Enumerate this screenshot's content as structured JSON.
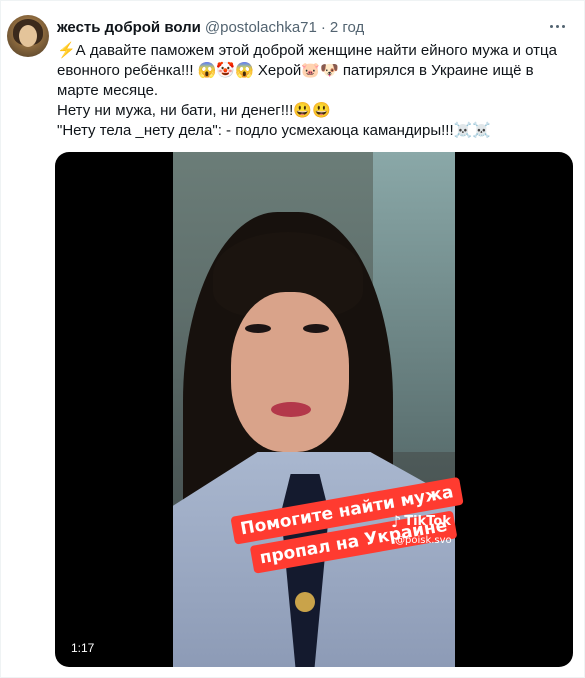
{
  "tweet": {
    "author_name": "жесть доброй воли",
    "handle": "@postolachka71",
    "separator": "·",
    "time": "2 год",
    "text_line1": "⚡А давайте паможем этой доброй женщине найти ейного мужа и отца евонного ребёнка!!! 😱🤡😱 Херой🐷🐶 патирялся в Украине ищё в марте месяце.",
    "text_line2": " Нету ни мужа, ни бати, ни денег!!!😃😃",
    "text_line3": " \"Нету тела _нету дела\": - подло усмехаюца камандиры!!!☠️☠️"
  },
  "video": {
    "caption_line1": "Помогите найти мужа",
    "caption_line2": "пропал на Украине",
    "watermark_brand": "TikTok",
    "watermark_handle": "@poisk.svo",
    "duration": "1:17"
  },
  "icons": {
    "more": "more-horizontal-icon",
    "tiktok": "tiktok-note-icon"
  },
  "colors": {
    "caption_bg": "#ff3b30",
    "text": "#0f1419",
    "secondary": "#536471"
  }
}
